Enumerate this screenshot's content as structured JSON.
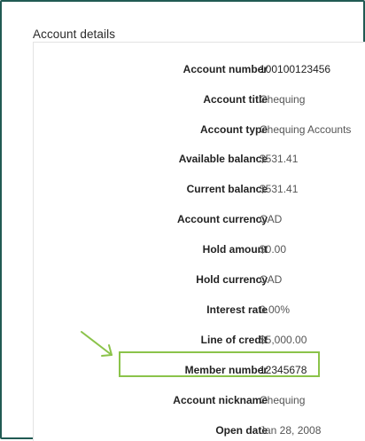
{
  "section": {
    "title": "Account details"
  },
  "rows": [
    {
      "label": "Account number",
      "value": "100100123456"
    },
    {
      "label": "Account title",
      "value": "Chequing"
    },
    {
      "label": "Account type",
      "value": "Chequing Accounts"
    },
    {
      "label": "Available balance",
      "value": "$531.41"
    },
    {
      "label": "Current balance",
      "value": "$531.41"
    },
    {
      "label": "Account currency",
      "value": "CAD"
    },
    {
      "label": "Hold amount",
      "value": "$0.00"
    },
    {
      "label": "Hold currency",
      "value": "CAD"
    },
    {
      "label": "Interest rate",
      "value": "0.00%"
    },
    {
      "label": "Line of credit",
      "value": "$5,000.00"
    },
    {
      "label": "Member number",
      "value": "12345678"
    },
    {
      "label": "Account nickname",
      "value": "Chequing"
    },
    {
      "label": "Open date",
      "value": "Jan 28, 2008"
    }
  ],
  "highlight": {
    "row": "Member number",
    "color": "#8bc34a"
  },
  "colors": {
    "frame_border": "#215a53",
    "accent_green": "#8bc34a"
  },
  "icons": {
    "pointer_arrow": "arrow-pointing-icon"
  }
}
